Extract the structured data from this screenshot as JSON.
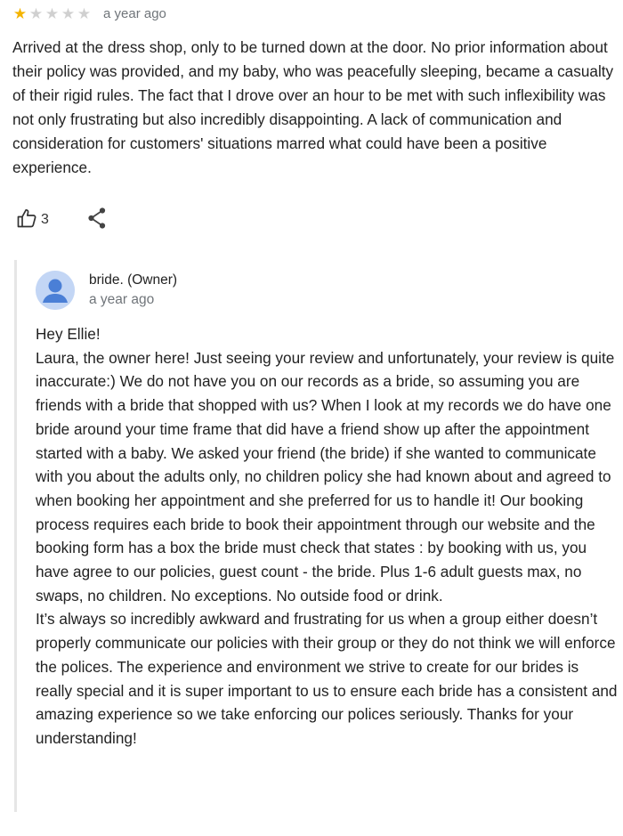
{
  "review": {
    "rating": 1,
    "max_rating": 5,
    "time_ago": "a year ago",
    "text": "Arrived at the dress shop, only to be turned down at the door. No prior information about their policy was provided, and my baby, who was peacefully sleeping, became a casualty of their rigid rules. The fact that I drove over an hour to be met with such inflexibility was not only frustrating but also incredibly disappointing. A lack of communication and consideration for customers' situations marred what could have been a positive experience.",
    "like_count": "3",
    "icons": {
      "like": "thumbs-up-icon",
      "share": "share-icon",
      "star": "star-icon"
    },
    "colors": {
      "star_filled": "#f4b400",
      "star_empty": "#d0d0d0"
    }
  },
  "owner_reply": {
    "name": "bride. (Owner)",
    "time_ago": "a year ago",
    "avatar_icon": "person-icon",
    "avatar_color": "#c3d6f5",
    "paragraphs": [
      "Hey Ellie!",
      "Laura, the owner here! Just seeing your review and unfortunately, your review is quite inaccurate:) We do not have you on our records as a bride, so assuming you are friends with a bride that shopped with us? When I look at my records we do have one bride around your time frame that did have a friend show up after the appointment started with a baby. We asked your friend (the bride) if she wanted to communicate with you about the adults only, no children policy she had known about and agreed to when booking her appointment and she preferred for us to handle it! Our booking process requires each bride to book their appointment through our website and the booking form has a box the bride must check that states : by booking with us, you have agree to our policies, guest count - the bride. Plus 1-6 adult guests max, no swaps, no children. No exceptions. No outside food or drink.",
      "It’s always so incredibly awkward and frustrating for us when a group either doesn’t properly communicate our policies with their group or they do not think we will enforce the polices. The experience and environment we strive to create for our brides is really special and it is super important to us to ensure each bride has a consistent and amazing experience so we take enforcing our polices seriously. Thanks for your understanding!"
    ]
  }
}
